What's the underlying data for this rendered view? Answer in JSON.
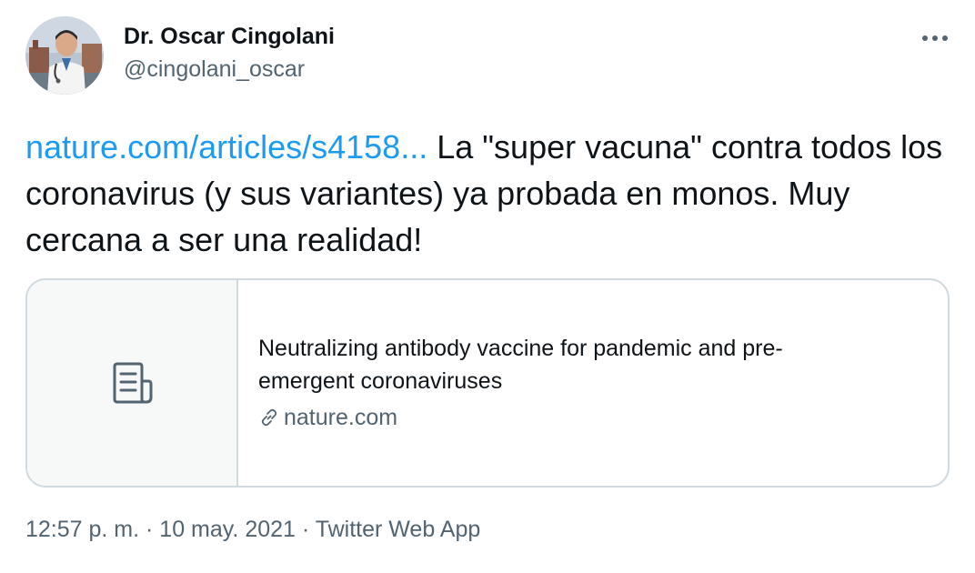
{
  "author": {
    "display_name": "Dr. Oscar Cingolani",
    "handle": "@cingolani_oscar",
    "avatar_icon": "profile-photo"
  },
  "tweet": {
    "link_text": "nature.com/articles/s4158...",
    "text": " La \"super vacuna\" contra todos los coronavirus (y sus variantes) ya probada en monos. Muy cercana a ser una realidad!"
  },
  "card": {
    "icon": "document-icon",
    "title": "Neutralizing antibody vaccine for pandemic and pre-emergent coronaviruses",
    "domain": "nature.com"
  },
  "meta": {
    "time": "12:57 p. m.",
    "separator": " · ",
    "date": "10 may. 2021",
    "source": "Twitter Web App"
  },
  "colors": {
    "link": "#1d9bf0",
    "secondary_text": "#536471",
    "border": "#cfd9de",
    "primary_text": "#0f1419"
  }
}
